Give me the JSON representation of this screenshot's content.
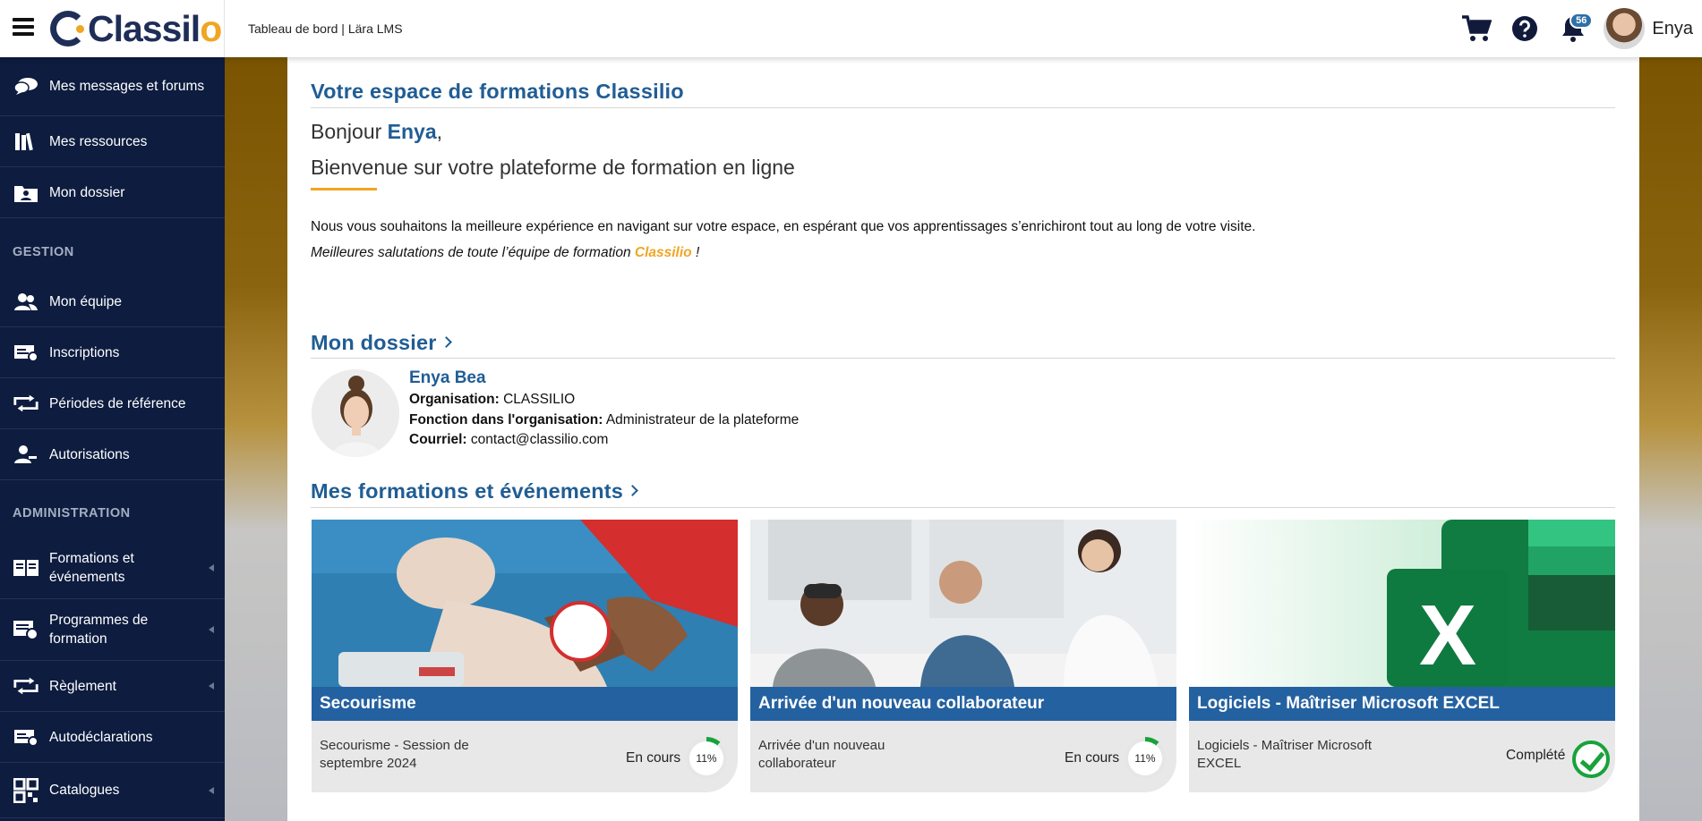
{
  "topbar": {
    "logo_text_a": "Classil",
    "logo_text_b": "o",
    "page_title": "Tableau de bord | Lära LMS",
    "notifications_count": "56",
    "user_name": "Enya"
  },
  "sidebar": {
    "items_top": [
      {
        "label": "Mes messages et forums",
        "icon": "chat-icon"
      },
      {
        "label": "Mes ressources",
        "icon": "books-icon"
      },
      {
        "label": "Mon dossier",
        "icon": "folder-user-icon"
      }
    ],
    "heading_gestion": "GESTION",
    "items_gestion": [
      {
        "label": "Mon équipe",
        "icon": "team-icon"
      },
      {
        "label": "Inscriptions",
        "icon": "registrations-icon"
      },
      {
        "label": "Périodes de référence",
        "icon": "periods-icon"
      },
      {
        "label": "Autorisations",
        "icon": "user-key-icon"
      }
    ],
    "heading_admin": "ADMINISTRATION",
    "items_admin": [
      {
        "label_l1": "Formations et",
        "label_l2": "événements",
        "icon": "book-open-icon"
      },
      {
        "label_l1": "Programmes de",
        "label_l2": "formation",
        "icon": "program-icon"
      },
      {
        "label": "Règlement",
        "icon": "rules-icon"
      },
      {
        "label": "Autodéclarations",
        "icon": "declaration-icon"
      },
      {
        "label": "Catalogues",
        "icon": "qr-grid-icon"
      }
    ]
  },
  "main": {
    "section1_title": "Votre espace de formations Classilio",
    "hello_prefix": "Bonjour ",
    "hello_name": "Enya",
    "hello_suffix": ",",
    "welcome": "Bienvenue sur votre plateforme de formation en ligne",
    "intro_1": "Nous vous souhaitons la meilleure expérience en navigant sur votre espace, en espérant que vos apprentissages s’enrichiront tout au long de votre visite.",
    "intro_2_prefix": "Meilleures salutations de toute l’équipe de formation ",
    "intro_2_brand": "Classilio",
    "intro_2_suffix": " !",
    "section2_title": "Mon dossier",
    "profile": {
      "name": "Enya Bea",
      "org_label": "Organisation:",
      "org_value": " CLASSILIO",
      "role_label": "Fonction dans l'organisation:",
      "role_value": " Administrateur de la plateforme",
      "mail_label": "Courriel:",
      "mail_value": " contact@classilio.com"
    },
    "section3_title": "Mes formations et événements",
    "cards": [
      {
        "title": "Secourisme",
        "subtitle": "Secourisme - Session de septembre 2024",
        "status": "En cours",
        "progress_label": "11%",
        "progress": 0.11
      },
      {
        "title": "Arrivée d'un nouveau collaborateur",
        "subtitle": "Arrivée d'un nouveau collaborateur",
        "status": "En cours",
        "progress_label": "11%",
        "progress": 0.11
      },
      {
        "title": "Logiciels - Maîtriser Microsoft EXCEL",
        "subtitle": "Logiciels - Maîtriser Microsoft EXCEL",
        "status": "Complété",
        "progress": 1.0
      }
    ],
    "excel_letter": "X"
  },
  "colors": {
    "sidebar_bg": "#0d1c3f",
    "accent_blue": "#205d94",
    "card_bar": "#2461a0",
    "brand_orange": "#f0a623",
    "progress_green": "#19a23a"
  }
}
